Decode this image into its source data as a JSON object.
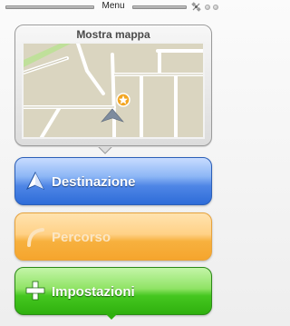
{
  "header": {
    "title": "Menu",
    "icons": [
      "satellite-icon",
      "page-indicator-dot",
      "page-indicator-dot"
    ]
  },
  "map_card": {
    "title": "Mostra mappa",
    "icons": [
      "position-arrow-icon",
      "star-marker-icon"
    ]
  },
  "menu": {
    "items": [
      {
        "label": "Destinazione",
        "icon": "navigation-arrow-icon",
        "color": "#4a86e8",
        "enabled": true
      },
      {
        "label": "Percorso",
        "icon": "route-curve-icon",
        "color": "#f7b13f",
        "enabled": false
      },
      {
        "label": "Impostazioni",
        "icon": "plus-icon",
        "color": "#3cbf1a",
        "enabled": true
      }
    ]
  }
}
